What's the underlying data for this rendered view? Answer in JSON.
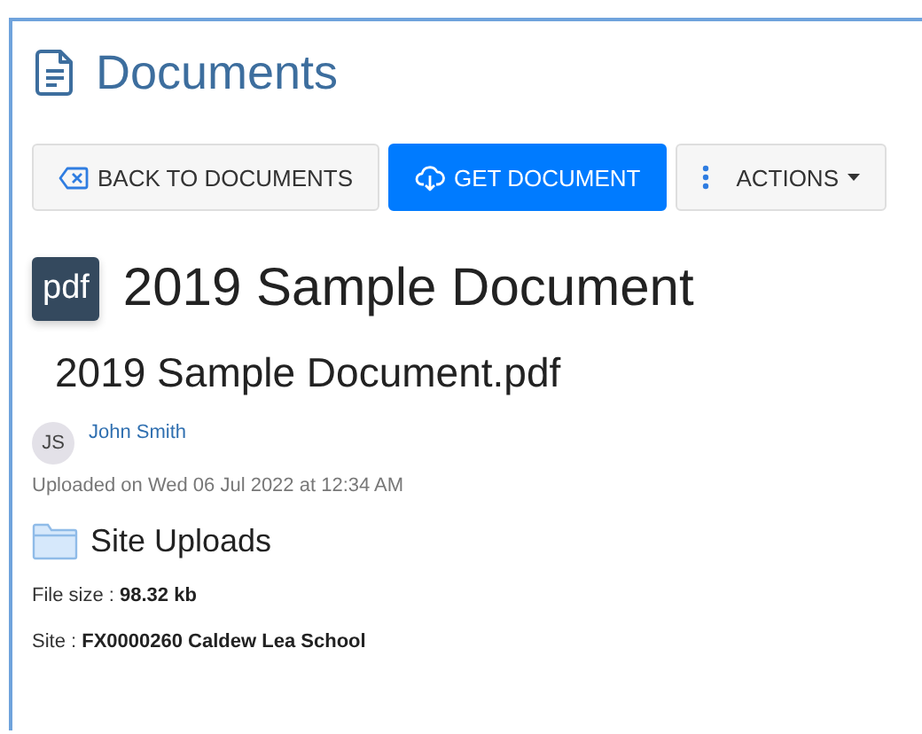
{
  "header": {
    "title": "Documents"
  },
  "buttons": [
    {
      "kind": "back",
      "label": "BACK TO DOCUMENTS"
    },
    {
      "kind": "primary",
      "label": "GET DOCUMENT"
    },
    {
      "kind": "dropdown",
      "label": "ACTIONS"
    }
  ],
  "document": {
    "type_badge": "pdf",
    "title": "2019 Sample Document",
    "filename": "2019 Sample Document.pdf"
  },
  "uploader": {
    "initials": "JS",
    "name": "John Smith"
  },
  "uploaded": "Uploaded on Wed 06 Jul 2022 at 12:34 AM",
  "folder": "Site Uploads",
  "details": [
    {
      "label": "File size : ",
      "value": "98.32 kb"
    },
    {
      "label": "Site : ",
      "value": "FX0000260 Caldew Lea School"
    }
  ]
}
